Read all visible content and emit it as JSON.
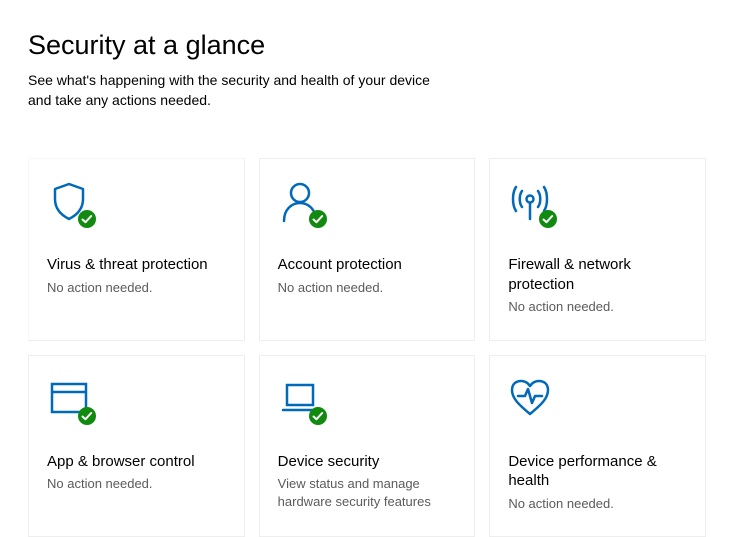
{
  "header": {
    "title": "Security at a glance",
    "subtitle": "See what's happening with the security and health of your device and take any actions needed."
  },
  "tiles": [
    {
      "title": "Virus & threat protection",
      "subtitle": "No action needed."
    },
    {
      "title": "Account protection",
      "subtitle": "No action needed."
    },
    {
      "title": "Firewall & network protection",
      "subtitle": "No action needed."
    },
    {
      "title": "App & browser control",
      "subtitle": "No action needed."
    },
    {
      "title": "Device security",
      "subtitle": "View status and manage hardware security features"
    },
    {
      "title": "Device performance & health",
      "subtitle": "No action needed."
    }
  ],
  "colors": {
    "accent": "#0069b8",
    "ok": "#128a10"
  }
}
